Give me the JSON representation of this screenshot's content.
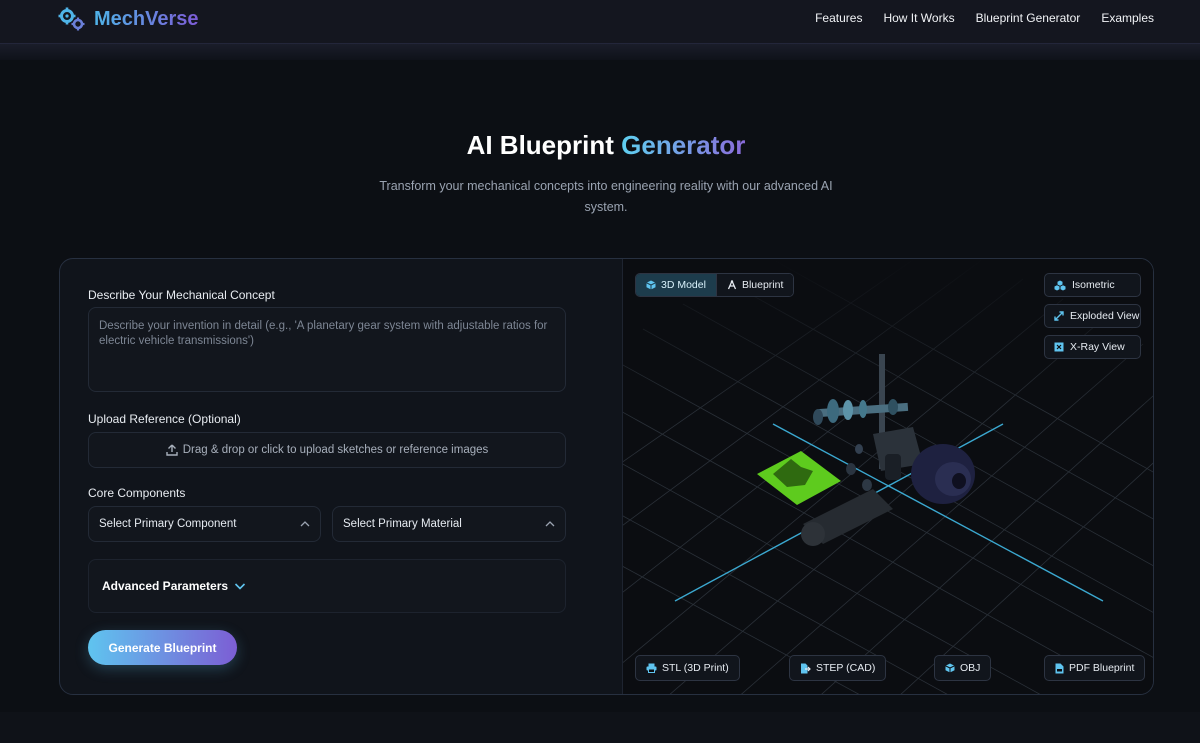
{
  "brand": {
    "name": "MechVerse"
  },
  "nav": {
    "links": [
      "Features",
      "How It Works",
      "Blueprint Generator",
      "Examples"
    ]
  },
  "hero": {
    "title_main": "AI Blueprint",
    "title_accent": "Generator",
    "subtitle": "Transform your mechanical concepts into engineering reality with our advanced AI system."
  },
  "form": {
    "concept_label": "Describe Your Mechanical Concept",
    "concept_placeholder": "Describe your invention in detail (e.g., 'A planetary gear system with adjustable ratios for electric vehicle transmissions')",
    "upload_label": "Upload Reference (Optional)",
    "upload_text": "Drag & drop or click to upload sketches or reference images",
    "components_label": "Core Components",
    "component_select": "Select Primary Component",
    "material_select": "Select Primary Material",
    "advanced_label": "Advanced Parameters",
    "generate_button": "Generate Blueprint"
  },
  "viewer": {
    "tabs": [
      {
        "label": "3D Model",
        "icon": "cube-icon",
        "active": true
      },
      {
        "label": "Blueprint",
        "icon": "compass-icon",
        "active": false
      }
    ],
    "view_modes": [
      {
        "label": "Isometric",
        "icon": "cubes-icon"
      },
      {
        "label": "Exploded View",
        "icon": "expand-icon"
      },
      {
        "label": "X-Ray View",
        "icon": "xray-icon"
      }
    ],
    "exports": [
      {
        "label": "STL (3D Print)",
        "icon": "printer-icon"
      },
      {
        "label": "STEP (CAD)",
        "icon": "file-export-icon"
      },
      {
        "label": "OBJ",
        "icon": "cube-icon"
      },
      {
        "label": "PDF Blueprint",
        "icon": "file-pdf-icon"
      }
    ]
  },
  "colors": {
    "accent_cyan": "#5fc4ef",
    "accent_purple": "#7c5ed4",
    "background": "#0c0f14",
    "card": "#10141b",
    "viewer_axis": "#3ba8d0",
    "model_plate": "#5ecb1e"
  }
}
